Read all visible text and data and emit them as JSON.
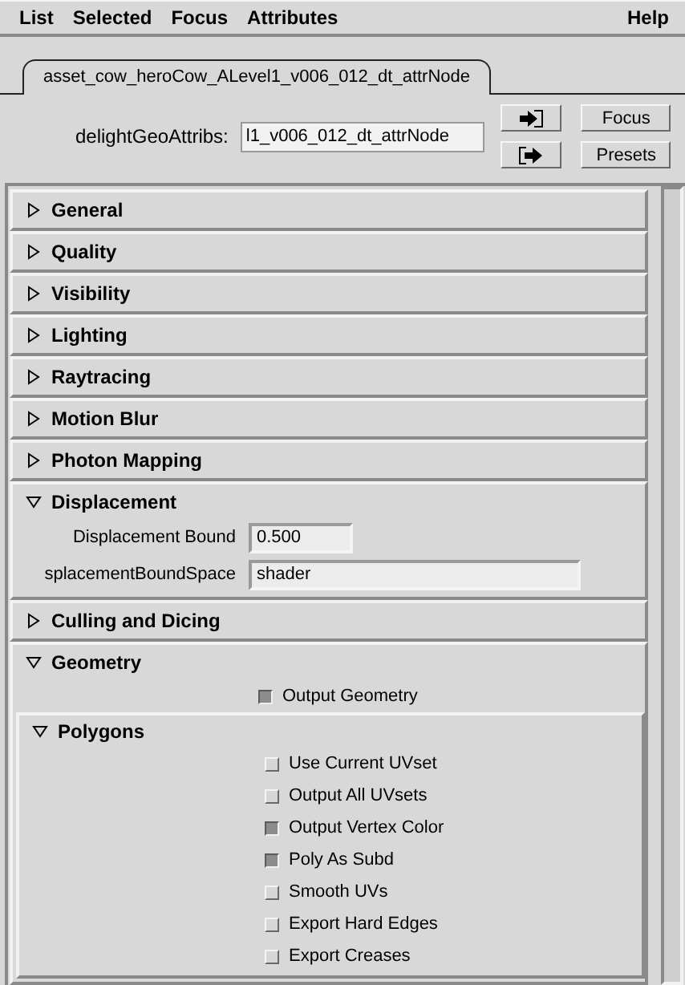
{
  "menu": [
    {
      "label": "List"
    },
    {
      "label": "Selected"
    },
    {
      "label": "Focus"
    },
    {
      "label": "Attributes"
    },
    {
      "label": "Help"
    }
  ],
  "tab": {
    "label": "asset_cow_heroCow_ALevel1_v006_012_dt_attrNode",
    "selected": true
  },
  "node": {
    "label": "delightGeoAttribs:",
    "value": "l1_v006_012_dt_attrNode",
    "buttons": [
      "Focus",
      "Presets"
    ]
  },
  "sections": [
    {
      "title": "General",
      "expanded": false
    },
    {
      "title": "Quality",
      "expanded": false
    },
    {
      "title": "Visibility",
      "expanded": false
    },
    {
      "title": "Lighting",
      "expanded": false
    },
    {
      "title": "Raytracing",
      "expanded": false
    },
    {
      "title": "Motion Blur",
      "expanded": false
    },
    {
      "title": "Photon Mapping",
      "expanded": false
    },
    {
      "title": "Displacement",
      "expanded": true,
      "items": [
        {
          "kind": "field",
          "label": "Displacement Bound",
          "value": "0.500",
          "wide": false
        },
        {
          "kind": "field",
          "label": "splacementBoundSpace",
          "value": "shader",
          "wide": true
        }
      ]
    },
    {
      "title": "Culling and Dicing",
      "expanded": false
    },
    {
      "title": "Geometry",
      "expanded": true,
      "items": [
        {
          "kind": "checkbox",
          "label": "Output Geometry",
          "checked": true
        },
        {
          "kind": "section",
          "title": "Polygons",
          "expanded": true,
          "items": [
            {
              "kind": "checkbox",
              "label": "Use Current UVset",
              "checked": false
            },
            {
              "kind": "checkbox",
              "label": "Output All UVsets",
              "checked": false
            },
            {
              "kind": "checkbox",
              "label": "Output Vertex Color",
              "checked": true
            },
            {
              "kind": "checkbox",
              "label": "Poly As Subd",
              "checked": true
            },
            {
              "kind": "checkbox",
              "label": "Smooth UVs",
              "checked": false
            },
            {
              "kind": "checkbox",
              "label": "Export Hard Edges",
              "checked": false
            },
            {
              "kind": "checkbox",
              "label": "Export Creases",
              "checked": false
            }
          ]
        }
      ]
    }
  ]
}
